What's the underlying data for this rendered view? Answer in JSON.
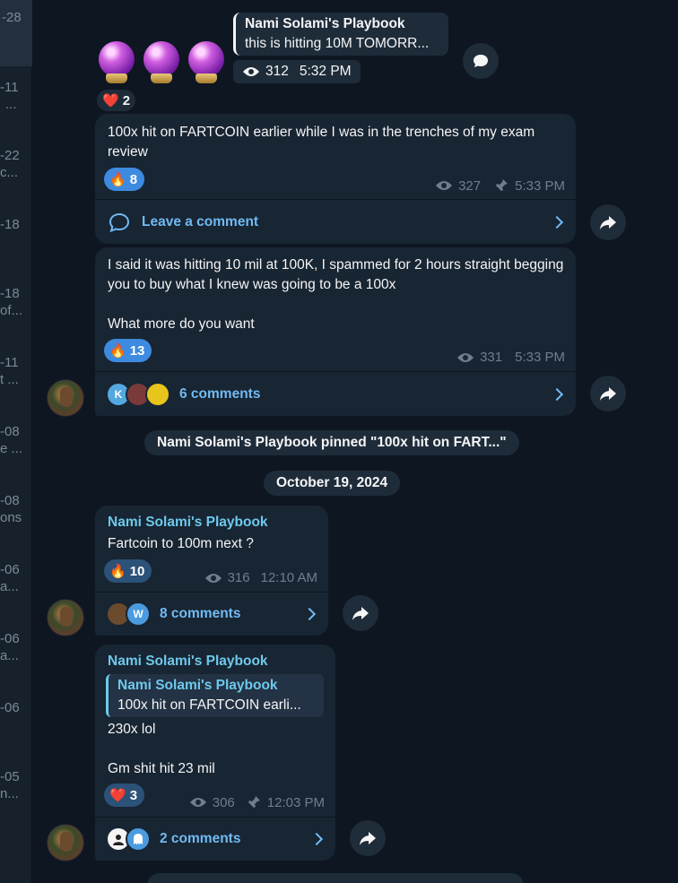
{
  "sidebar_fragments": [
    {
      "date": "-28",
      "preview": ""
    },
    {
      "date": "-11",
      "preview": "..."
    },
    {
      "date": "-22",
      "preview": "c..."
    },
    {
      "date": "-18",
      "preview": ""
    },
    {
      "date": "-18",
      "preview": "of..."
    },
    {
      "date": "-11",
      "preview": "t ..."
    },
    {
      "date": "-08",
      "preview": "e ..."
    },
    {
      "date": "-08",
      "preview": "ons"
    },
    {
      "date": "-06",
      "preview": "a..."
    },
    {
      "date": "-06",
      "preview": "a..."
    },
    {
      "date": "-06",
      "preview": ""
    },
    {
      "date": "-05",
      "preview": "n..."
    }
  ],
  "messages": {
    "m1": {
      "reply_sender": "Nami Solami's Playbook",
      "reply_text": "this is hitting 10M TOMORR...",
      "views": "312",
      "time": "5:32 PM",
      "reaction_emoji": "❤️",
      "reaction_count": "2"
    },
    "m2": {
      "text": "100x hit on FARTCOIN earlier while I was in the trenches of my exam review",
      "reaction_emoji": "🔥",
      "reaction_count": "8",
      "views": "327",
      "time": "5:33 PM",
      "comment_label": "Leave a comment"
    },
    "m3": {
      "text": "I said it was hitting 10 mil at 100K, I spammed for 2 hours straight begging you to buy what I knew was going to be a 100x\n\nWhat more do you want",
      "reaction_emoji": "🔥",
      "reaction_count": "13",
      "views": "331",
      "time": "5:33 PM",
      "comment_label": "6 comments",
      "commenter_initial": "K"
    },
    "m4": {
      "sender": "Nami Solami's Playbook",
      "text": "Fartcoin to 100m next ?",
      "reaction_emoji": "🔥",
      "reaction_count": "10",
      "views": "316",
      "time": "12:10 AM",
      "comment_label": "8 comments",
      "commenter_initial": "W"
    },
    "m5": {
      "sender": "Nami Solami's Playbook",
      "quote_sender": "Nami Solami's Playbook",
      "quote_text": "100x hit on FARTCOIN earli...",
      "text": "230x lol\n\nGm shit hit 23 mil",
      "reaction_emoji": "❤️",
      "reaction_count": "3",
      "views": "306",
      "time": "12:03 PM",
      "comment_label": "2 comments"
    }
  },
  "service": {
    "pinned": "Nami Solami's Playbook pinned \"100x hit on FART...\"",
    "date": "October 19, 2024"
  },
  "colors": {
    "background": "#0e1621",
    "bubble": "#182533",
    "accent": "#71baf3",
    "sender": "#6ec9ec"
  }
}
